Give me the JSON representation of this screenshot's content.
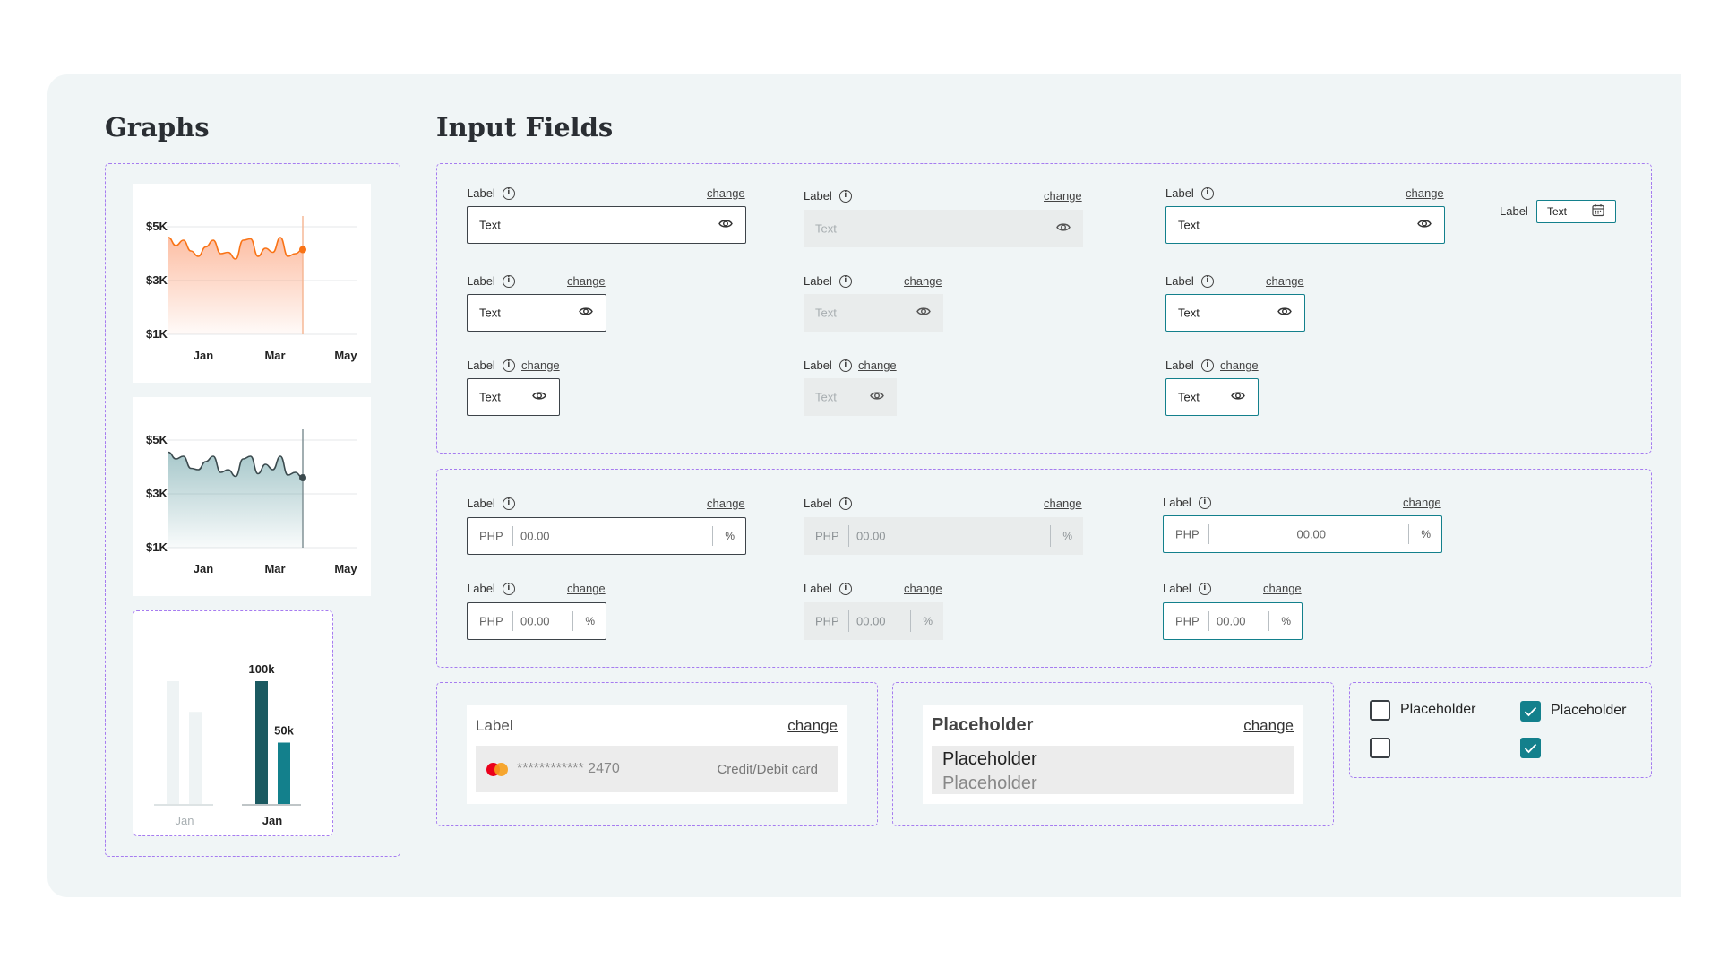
{
  "sections": {
    "graphs_title": "Graphs",
    "inputs_title": "Input Fields"
  },
  "colors": {
    "accent": "#13808c",
    "orange": "#f97316",
    "dashed": "#a67cf0",
    "teal_dark": "#1b5a61"
  },
  "chart_data": [
    {
      "type": "area",
      "series_color": "#f97316",
      "categories": [
        "Jan",
        "Mar",
        "May"
      ],
      "y_ticks": [
        "$5K",
        "$3K",
        "$1K"
      ],
      "ylim": [
        1000,
        5000
      ],
      "values": [
        4600,
        4300,
        4500,
        4100,
        3900,
        4250,
        4500,
        4000,
        4050,
        3800,
        4500,
        4550,
        3900,
        4200,
        4050,
        4600,
        3900,
        4000,
        4150
      ],
      "highlight_index": 18,
      "grid": true
    },
    {
      "type": "area",
      "series_color": "#3b4a4e",
      "categories": [
        "Jan",
        "Mar",
        "May"
      ],
      "y_ticks": [
        "$5K",
        "$3K",
        "$1K"
      ],
      "ylim": [
        1000,
        5000
      ],
      "values": [
        4550,
        4300,
        4400,
        3950,
        3900,
        4200,
        4400,
        3800,
        3900,
        3650,
        4300,
        4400,
        3750,
        4100,
        3900,
        4400,
        3700,
        3800,
        3600
      ],
      "highlight_index": 18,
      "grid": true
    },
    {
      "type": "bar",
      "categories": [
        "Jan",
        "Jan"
      ],
      "series": [
        {
          "values": [
            100,
            75
          ],
          "muted": true
        },
        {
          "values": [
            100,
            50
          ],
          "data_labels": [
            "100k",
            "50k"
          ]
        }
      ],
      "ylim": [
        0,
        100
      ]
    }
  ],
  "text_fields": {
    "label": "Label",
    "change": "change",
    "value": "Text",
    "date_label": "Label",
    "date_value": "Text"
  },
  "money_fields": {
    "prefix": "PHP",
    "value": "00.00",
    "suffix": "%"
  },
  "payment": {
    "label": "Label",
    "change": "change",
    "masked_number": "************ 2470",
    "type": "Credit/Debit card"
  },
  "select": {
    "title": "Placeholder",
    "change": "change",
    "option1": "Placeholder",
    "option2": "Placeholder"
  },
  "checkboxes": [
    {
      "label": "Placeholder",
      "checked": false
    },
    {
      "label": "Placeholder",
      "checked": true
    },
    {
      "label": "",
      "checked": false
    },
    {
      "label": "",
      "checked": true
    }
  ]
}
